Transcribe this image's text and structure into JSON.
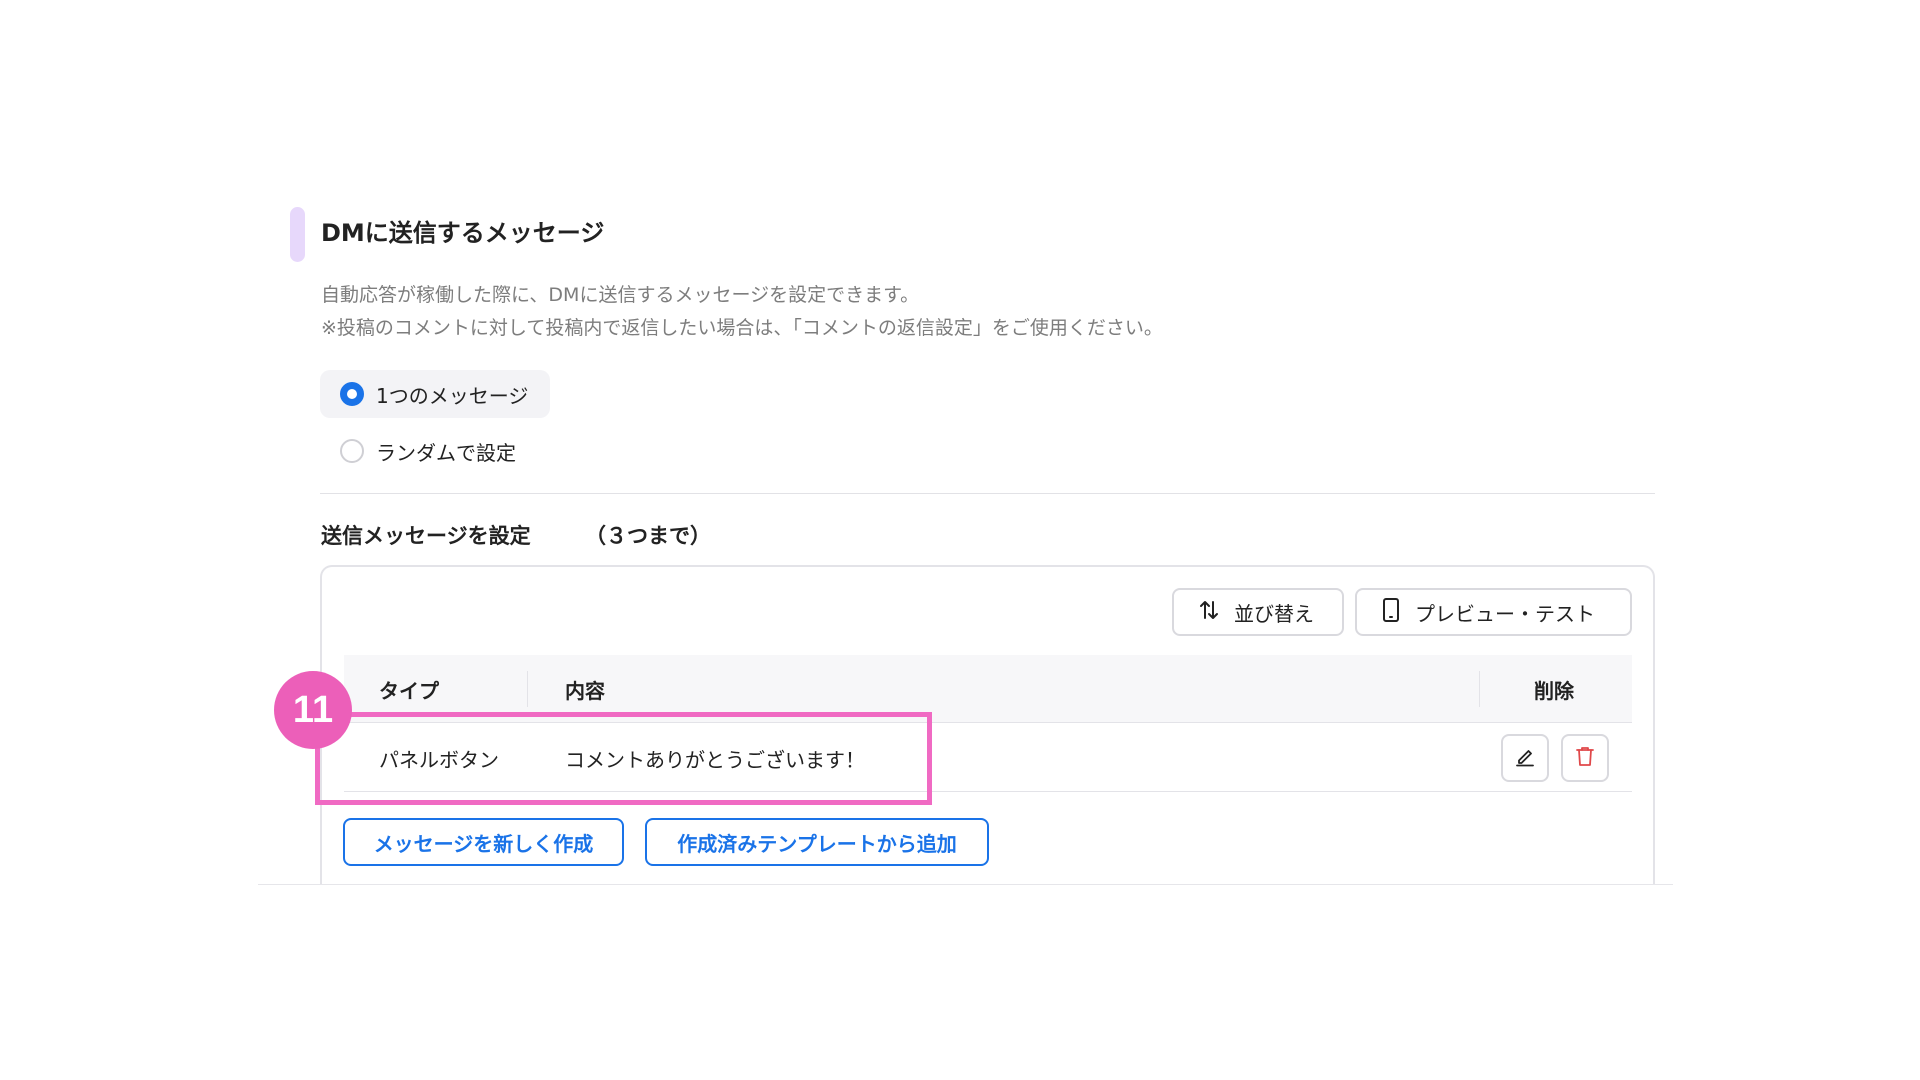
{
  "section": {
    "title": "DMに送信するメッセージ",
    "description_line1": "自動応答が稼働した際に、DMに送信するメッセージを設定できます。",
    "description_line2": "※投稿のコメントに対して投稿内で返信したい場合は、「コメントの返信設定」をご使用ください。"
  },
  "radio_options": [
    {
      "label": "1つのメッセージ",
      "selected": true
    },
    {
      "label": "ランダムで設定",
      "selected": false
    }
  ],
  "messages": {
    "title": "送信メッセージを設定",
    "note": "（３つまで）",
    "sort_label": "並び替え",
    "preview_label": "プレビュー・テスト",
    "columns": {
      "type": "タイプ",
      "content": "内容",
      "delete": "削除"
    },
    "rows": [
      {
        "type": "パネルボタン",
        "content": "コメントありがとうございます！"
      }
    ],
    "new_button": "メッセージを新しく作成",
    "template_button": "作成済みテンプレートから追加"
  },
  "annotation": {
    "number": "11"
  },
  "colors": {
    "accent": "#1a73e8",
    "annotation": "#ec5fb9",
    "section_marker": "#e7d8fb",
    "delete_icon": "#e0484a"
  }
}
